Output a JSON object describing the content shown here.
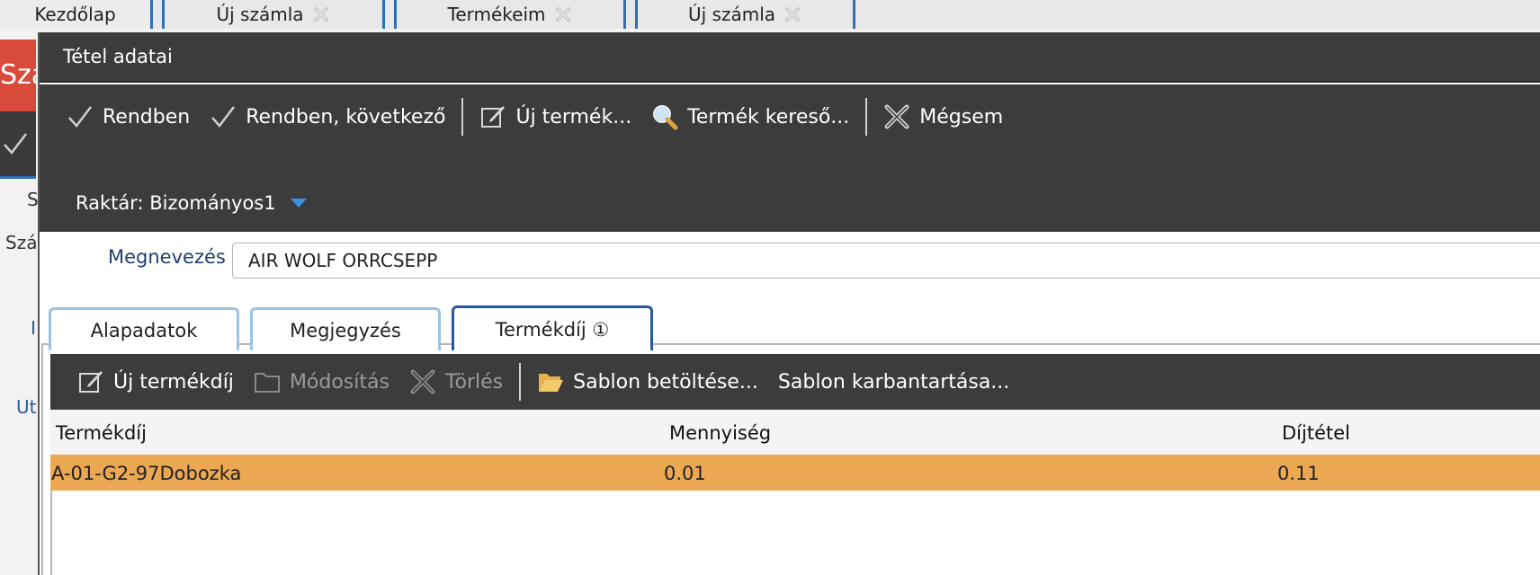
{
  "top_tabs": [
    {
      "label": "Kezdőlap",
      "closable": false
    },
    {
      "label": "Új számla",
      "closable": true
    },
    {
      "label": "Termékeim",
      "closable": true
    },
    {
      "label": "Új számla",
      "closable": true
    }
  ],
  "background": {
    "red_text": "Szá",
    "labels": [
      "S",
      "Szá",
      "I",
      "Ut"
    ]
  },
  "dialog": {
    "title": "Tétel adatai",
    "toolbar": {
      "ok": "Rendben",
      "ok_next": "Rendben, következő",
      "new_product": "Új termék...",
      "product_search": "Termék kereső...",
      "cancel": "Mégsem"
    },
    "warehouse": "Raktár: Bizományos1",
    "name_label": "Megnevezés :",
    "name_value": "AIR WOLF ORRCSEPP",
    "tabs": [
      "Alapadatok",
      "Megjegyzés",
      "Termékdíj ①"
    ],
    "sub_toolbar": {
      "new_fee": "Új termékdíj",
      "modify": "Módosítás",
      "delete": "Törlés",
      "load_template": "Sablon betöltése...",
      "manage_template": "Sablon karbantartása..."
    },
    "grid": {
      "columns": [
        "Termékdíj",
        "Mennyiség",
        "Díjtétel"
      ],
      "rows": [
        {
          "fee": "A-01-G2-97Dobozka",
          "qty": "0.01",
          "rate": "0.11"
        }
      ]
    }
  },
  "colors": {
    "toolbar_bg": "#3c3c3c",
    "selected_row": "#eba752",
    "tab_border_active": "#2458a0",
    "tab_border": "#9ac3e6",
    "accent_blue": "#2e6fb5",
    "red_header": "#d84a3a"
  }
}
